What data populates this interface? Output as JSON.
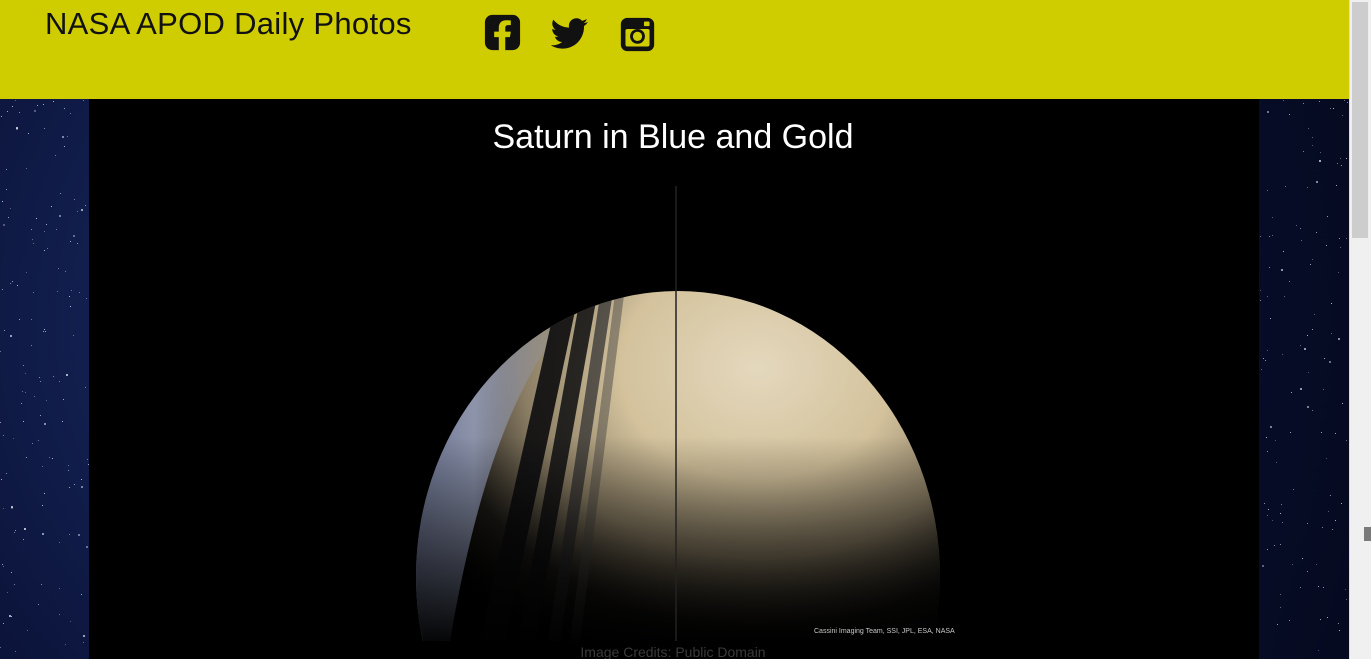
{
  "header": {
    "site_title": "NASA APOD Daily Photos",
    "social": [
      {
        "name": "facebook-icon"
      },
      {
        "name": "twitter-icon"
      },
      {
        "name": "instagram-icon"
      }
    ],
    "background_color": "#cfcc00"
  },
  "main": {
    "photo_title": "Saturn in Blue and Gold",
    "image_watermark": "Cassini Imaging Team, SSI, JPL, ESA, NASA",
    "credits": "Image Credits: Public Domain"
  }
}
